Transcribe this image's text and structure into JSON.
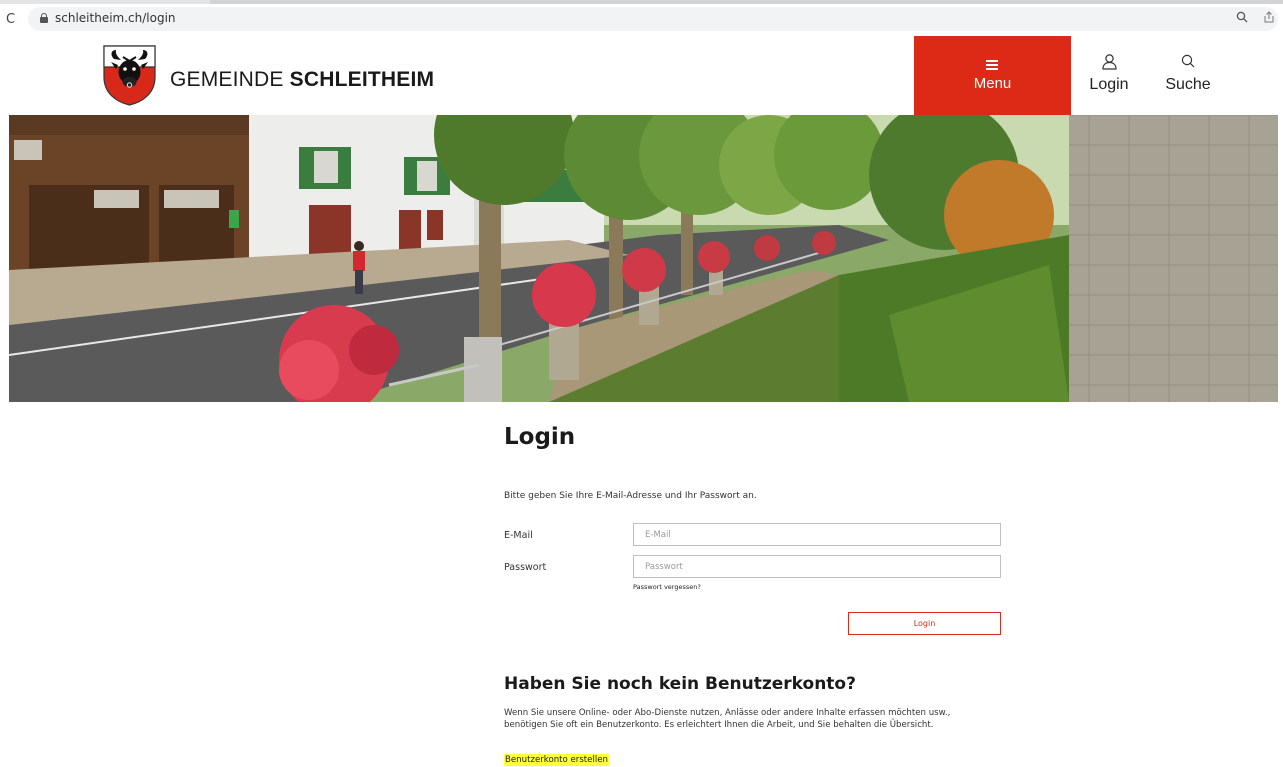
{
  "browser": {
    "reload_glyph": "C",
    "url": "schleitheim.ch/login",
    "zoom_icon": "magnifier-icon"
  },
  "header": {
    "title_light": "GEMEINDE ",
    "title_bold": "SCHLEITHEIM",
    "menu_label": "Menu",
    "login_label": "Login",
    "search_label": "Suche",
    "accent_color": "#dc2a16"
  },
  "login": {
    "title": "Login",
    "intro": "Bitte geben Sie Ihre E-Mail-Adresse und Ihr Passwort an.",
    "email_label": "E-Mail",
    "email_placeholder": "E-Mail",
    "email_value": "",
    "password_label": "Passwort",
    "password_placeholder": "Passwort",
    "password_value": "",
    "forgot_label": "Passwort vergessen?",
    "submit_label": "Login"
  },
  "register": {
    "title": "Haben Sie noch kein Benutzerkonto?",
    "text_line1": "Wenn Sie unsere Online- oder Abo-Dienste nutzen, Anlässe oder andere Inhalte erfassen möchten usw.,",
    "text_line2": "benötigen Sie oft ein Benutzerkonto. Es erleichtert Ihnen die Arbeit, und Sie behalten die Übersicht.",
    "link_label": "Benutzerkonto erstellen",
    "link_highlight": "#ffff3d"
  }
}
